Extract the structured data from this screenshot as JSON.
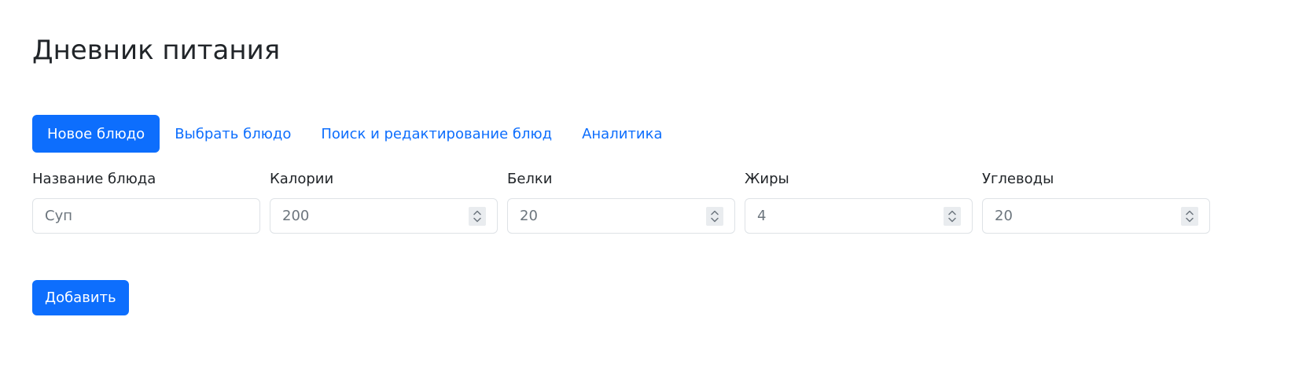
{
  "page": {
    "title": "Дневник питания"
  },
  "tabs": [
    {
      "label": "Новое блюдо",
      "active": true
    },
    {
      "label": "Выбрать блюдо",
      "active": false
    },
    {
      "label": "Поиск и редактирование блюд",
      "active": false
    },
    {
      "label": "Аналитика",
      "active": false
    }
  ],
  "form": {
    "fields": [
      {
        "label": "Название блюда",
        "placeholder": "Суп",
        "type": "text"
      },
      {
        "label": "Калории",
        "placeholder": "200",
        "type": "number"
      },
      {
        "label": "Белки",
        "placeholder": "20",
        "type": "number"
      },
      {
        "label": "Жиры",
        "placeholder": "4",
        "type": "number"
      },
      {
        "label": "Углеводы",
        "placeholder": "20",
        "type": "number"
      }
    ],
    "submit_label": "Добавить"
  },
  "colors": {
    "accent": "#0d6efd",
    "text": "#212529",
    "placeholder": "#6c757d",
    "border": "#dee2e6"
  },
  "icons": {
    "spinner": "chevron-up-down-icon"
  }
}
